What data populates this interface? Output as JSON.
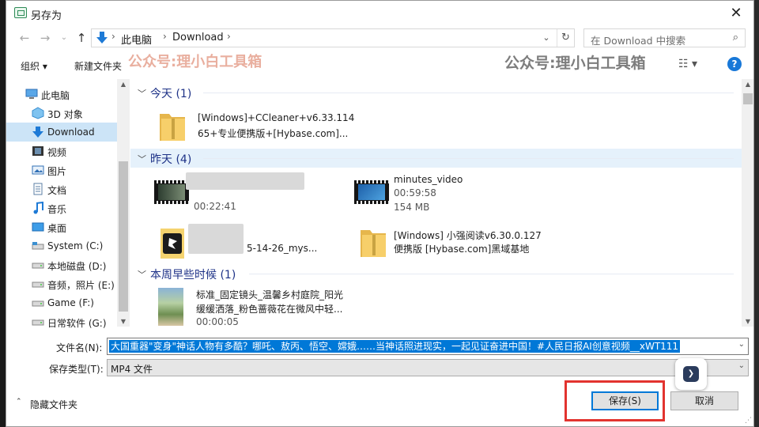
{
  "window": {
    "title": "另存为"
  },
  "nav": {
    "breadcrumbs": [
      "此电脑",
      "Download"
    ],
    "search_placeholder": "在 Download 中搜索"
  },
  "toolbar": {
    "organize": "组织 ▾",
    "new_folder": "新建文件夹",
    "watermark_red": "公众号:理小白工具箱",
    "watermark_gray": "公众号:理小白工具箱"
  },
  "sidebar": {
    "items": [
      {
        "label": "此电脑",
        "icon": "computer-icon"
      },
      {
        "label": "3D 对象",
        "icon": "cube-icon"
      },
      {
        "label": "Download",
        "icon": "download-arrow-icon"
      },
      {
        "label": "视频",
        "icon": "video-icon"
      },
      {
        "label": "图片",
        "icon": "picture-icon"
      },
      {
        "label": "文档",
        "icon": "document-icon"
      },
      {
        "label": "音乐",
        "icon": "music-icon"
      },
      {
        "label": "桌面",
        "icon": "desktop-icon"
      },
      {
        "label": "System (C:)",
        "icon": "drive-icon"
      },
      {
        "label": "本地磁盘 (D:)",
        "icon": "drive-icon"
      },
      {
        "label": "音频，照片 (E:)",
        "icon": "drive-icon"
      },
      {
        "label": "Game (F:)",
        "icon": "drive-icon"
      },
      {
        "label": "日常软件 (G:)",
        "icon": "drive-icon"
      }
    ]
  },
  "groups": [
    {
      "title": "今天 (1)",
      "files": [
        {
          "line1": "[Windows]+CCleaner+v6.33.114",
          "line2": "65+专业便携版+[Hybase.com]...",
          "kind": "folder"
        }
      ]
    },
    {
      "title": "昨天 (4)",
      "files": [
        {
          "line1": "",
          "line2": "",
          "line3": "00:22:41",
          "kind": "video"
        },
        {
          "line1": "minutes_video",
          "line2": "00:59:58",
          "line3": "154 MB",
          "kind": "video"
        },
        {
          "line1": "5-14-26_mys...",
          "kind": "app"
        },
        {
          "line1": "[Windows] 小强阅读v6.30.0.127",
          "line2": "便携版 [Hybase.com]黑域基地",
          "kind": "folder"
        }
      ]
    },
    {
      "title": "本周早些时候 (1)",
      "files": [
        {
          "line1": "标准_固定镜头_温馨乡村庭院_阳光",
          "line2": "缓缓洒落_粉色蔷薇花在微风中轻...",
          "line3": "00:00:05",
          "kind": "video"
        }
      ]
    }
  ],
  "form": {
    "filename_label": "文件名(N):",
    "filename_value": "大国重器\"变身\"神话人物有多酷？哪吒、敖丙、悟空、嫦娥……当神话照进现实，一起见证奋进中国！#人民日报AI创意视频__xWT111",
    "filetype_label": "保存类型(T):",
    "filetype_value": "MP4 文件"
  },
  "footer": {
    "hide_folders": "隐藏文件夹",
    "save": "保存(S)",
    "cancel": "取消"
  },
  "colors": {
    "accent": "#0078d7",
    "highlight": "#e2332f",
    "selection": "#cce4f7"
  }
}
